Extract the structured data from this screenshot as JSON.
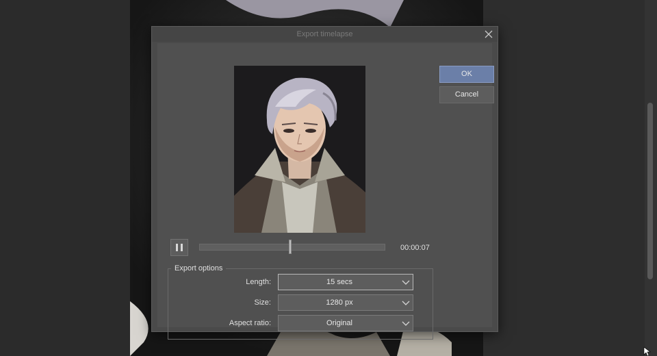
{
  "dialog": {
    "title": "Export timelapse",
    "ok_label": "OK",
    "cancel_label": "Cancel",
    "playback": {
      "state": "playing",
      "position_fraction": 0.49,
      "time": "00:00:07"
    },
    "export_options": {
      "legend": "Export options",
      "length": {
        "label": "Length:",
        "value": "15 secs"
      },
      "size": {
        "label": "Size:",
        "value": "1280 px"
      },
      "aspect_ratio": {
        "label": "Aspect ratio:",
        "value": "Original"
      }
    }
  },
  "colors": {
    "ok_accent": "#6b7fa8",
    "dialog_bg": "#505050"
  },
  "icons": [
    "close-icon",
    "pause-icon",
    "chevron-down-icon",
    "mouse-cursor-icon"
  ]
}
